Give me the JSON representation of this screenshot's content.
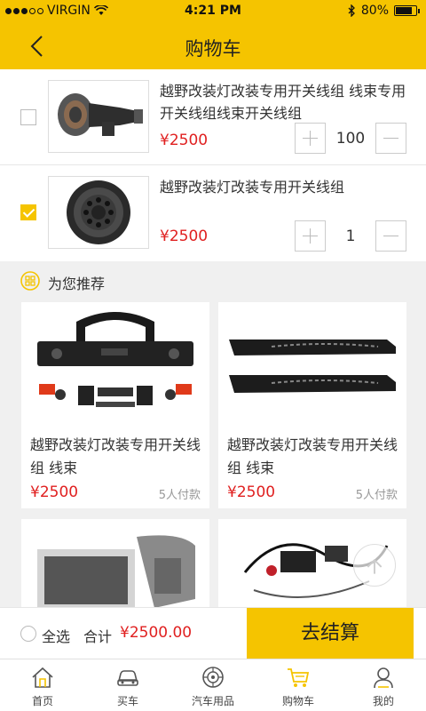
{
  "status_bar": {
    "carrier": "VIRGIN",
    "time": "4:21 PM",
    "battery": "80%",
    "battery_level": 0.8
  },
  "nav": {
    "title": "购物车",
    "back_icon": "chevron-left-icon"
  },
  "cart": {
    "items": [
      {
        "name": "越野改装灯改装专用开关线组 线束专用开关线组线束开关线组",
        "price": "¥2500",
        "quantity": "100",
        "checked": false
      },
      {
        "name": "越野改装灯改装专用开关线组",
        "price": "¥2500",
        "quantity": "1",
        "checked": true
      }
    ]
  },
  "recommend": {
    "title": "为您推荐",
    "products": [
      {
        "name": "越野改装灯改装专用开关线组 线束",
        "price": "¥2500",
        "paid": "5人付款"
      },
      {
        "name": "越野改装灯改装专用开关线组 线束",
        "price": "¥2500",
        "paid": "5人付款"
      },
      {
        "name": "",
        "price": "",
        "paid": ""
      },
      {
        "name": "",
        "price": "",
        "paid": ""
      }
    ]
  },
  "checkout": {
    "select_all": "全选",
    "total_label": "合计",
    "total_value": "¥2500.00",
    "button": "去结算"
  },
  "tabs": [
    {
      "label": "首页",
      "icon": "home-icon"
    },
    {
      "label": "买车",
      "icon": "car-icon"
    },
    {
      "label": "汽车用品",
      "icon": "wheel-icon"
    },
    {
      "label": "购物车",
      "icon": "cart-icon"
    },
    {
      "label": "我的",
      "icon": "user-icon"
    }
  ],
  "colors": {
    "brand": "#f5c400",
    "price": "#e02020"
  }
}
